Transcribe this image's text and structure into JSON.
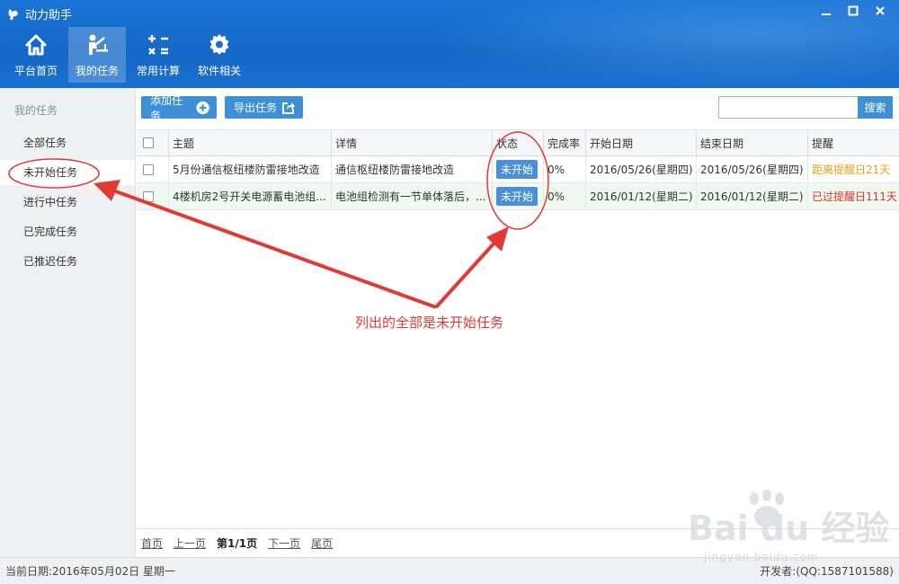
{
  "app": {
    "title": "动力助手"
  },
  "nav": [
    {
      "label": "平台首页",
      "icon": "home-icon"
    },
    {
      "label": "我的任务",
      "icon": "task-icon"
    },
    {
      "label": "常用计算",
      "icon": "calculator-icon"
    },
    {
      "label": "软件相关",
      "icon": "gear-icon"
    }
  ],
  "sidebar": {
    "title": "我的任务",
    "items": [
      "全部任务",
      "未开始任务",
      "进行中任务",
      "已完成任务",
      "已推迟任务"
    ],
    "selected_index": 1
  },
  "toolbar": {
    "add_label": "添加任务",
    "export_label": "导出任务",
    "search_placeholder": "",
    "search_label": "搜索"
  },
  "table": {
    "headers": [
      "主题",
      "详情",
      "状态",
      "完成率",
      "开始日期",
      "结束日期",
      "提醒"
    ],
    "rows": [
      {
        "subject": "5月份通信枢纽楼防雷接地改造",
        "detail": "通信枢纽楼防雷接地改造",
        "status": "未开始",
        "rate": "0%",
        "start": "2016/05/26(星期四)",
        "end": "2016/05/26(星期四)",
        "remind": "距离提醒日21天"
      },
      {
        "subject": "4楼机房2号开关电源蓄电池组...",
        "detail": "电池组检测有一节单体落后，...",
        "status": "未开始",
        "rate": "0%",
        "start": "2016/01/12(星期二)",
        "end": "2016/01/12(星期二)",
        "remind": "已过提醒日111天"
      }
    ]
  },
  "pager": {
    "first": "首页",
    "prev": "上一页",
    "current": "第1/1页",
    "next": "下一页",
    "last": "尾页"
  },
  "statusbar": {
    "date": "当前日期:2016年05月02日  星期一",
    "developer": "开发者:(QQ:1587101588)"
  },
  "annotation": {
    "text": "列出的全部是未开始任务",
    "color": "#e23a33"
  },
  "watermark": {
    "main": "Bai du 经验",
    "sub": "jingyan.baidu.com"
  },
  "colors": {
    "titlebar": "#1668c6",
    "button": "#3d8fd8",
    "status_badge": "#4a90d9",
    "remind_future": "#e8a21a",
    "remind_past": "#e2302a"
  }
}
